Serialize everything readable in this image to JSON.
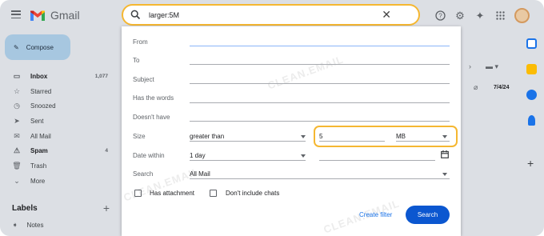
{
  "app": {
    "name": "Gmail"
  },
  "search": {
    "query": "larger:5M"
  },
  "compose": {
    "label": "Compose"
  },
  "nav": [
    {
      "label": "Inbox",
      "count": "1,077",
      "icon": "inbox-icon",
      "bold": true
    },
    {
      "label": "Starred",
      "count": "",
      "icon": "star-icon",
      "bold": false
    },
    {
      "label": "Snoozed",
      "count": "",
      "icon": "clock-icon",
      "bold": false
    },
    {
      "label": "Sent",
      "count": "",
      "icon": "send-icon",
      "bold": false
    },
    {
      "label": "All Mail",
      "count": "",
      "icon": "all-mail-icon",
      "bold": false
    },
    {
      "label": "Spam",
      "count": "4",
      "icon": "spam-icon",
      "bold": true
    },
    {
      "label": "Trash",
      "count": "",
      "icon": "trash-icon",
      "bold": false
    },
    {
      "label": "More",
      "count": "",
      "icon": "chevron-down-icon",
      "bold": false
    }
  ],
  "labels": {
    "title": "Labels",
    "items": [
      "Notes"
    ]
  },
  "advanced": {
    "from_label": "From",
    "to_label": "To",
    "subject_label": "Subject",
    "has_words_label": "Has the words",
    "doesnt_have_label": "Doesn't have",
    "size_label": "Size",
    "size_operator": "greater than",
    "size_value": "5",
    "size_unit": "MB",
    "date_label": "Date within",
    "date_value": "1 day",
    "search_in_label": "Search",
    "search_in_value": "All Mail",
    "has_attachment": "Has attachment",
    "no_chats": "Don't include chats",
    "create_filter": "Create filter",
    "search_button": "Search"
  },
  "background": {
    "date": "7/4/24"
  },
  "watermark": "CLEAN.EMAIL",
  "colors": {
    "highlight": "#f5b731",
    "primary": "#0b57d0",
    "link": "#1a73e8"
  }
}
